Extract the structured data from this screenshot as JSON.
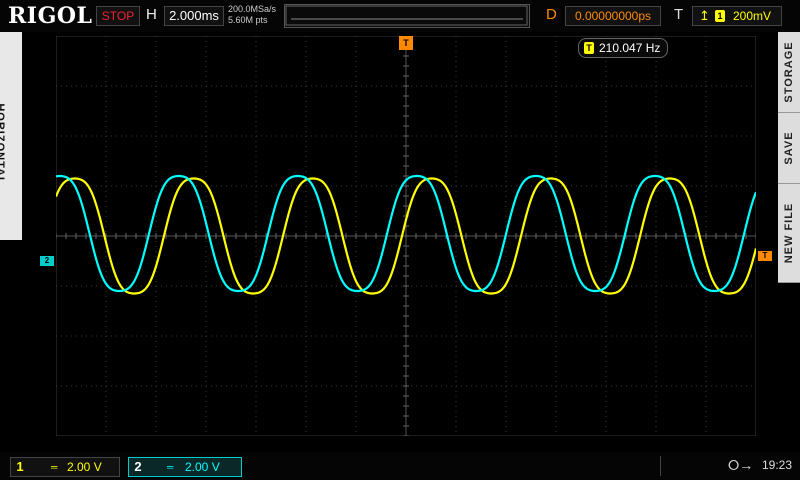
{
  "header": {
    "brand": "RIGOL",
    "run_state": "STOP",
    "horizontal_label": "H",
    "timebase": "2.000ms",
    "sample_rate": "200.0MSa/s",
    "memory_depth": "5.60M pts",
    "delay_label": "D",
    "delay_value": "0.00000000ps",
    "trigger_label": "T",
    "trigger_edge_icon": "rising-edge-icon",
    "trigger_source": "1",
    "trigger_level": "200mV",
    "trigger_position_marker": "T"
  },
  "left_menu": {
    "label": "HORIZONTAL"
  },
  "right_menu": {
    "tabs": [
      "STORAGE",
      "SAVE",
      "NEW FILE"
    ]
  },
  "measurement": {
    "source": "T",
    "frequency": "210.047 Hz"
  },
  "markers": {
    "ch2_offset": "2",
    "trigger_level": "T"
  },
  "channels": [
    {
      "number": "1",
      "coupling": "DC",
      "scale": "2.00 V",
      "color": "#ffff00"
    },
    {
      "number": "2",
      "coupling": "DC",
      "scale": "2.00 V",
      "color": "#00ffff"
    }
  ],
  "status": {
    "usb_icon": "usb-icon",
    "time": "19:23"
  },
  "colors": {
    "accent": "#ff8a00",
    "ch1": "#ffff00",
    "ch2": "#00ffff",
    "stop": "#ee2233"
  },
  "chart_data": {
    "type": "line",
    "xlabel": "",
    "ylabel": "",
    "x_divisions": 14,
    "y_divisions": 8,
    "timebase_per_div_ms": 2.0,
    "volts_per_div": 2.0,
    "grid": true,
    "series": [
      {
        "name": "1",
        "frequency_hz": 210.047,
        "amplitude_div": 1.35,
        "offset_div": 0.0,
        "phase_deg": 0
      },
      {
        "name": "2",
        "frequency_hz": 210.047,
        "amplitude_div": 1.35,
        "offset_div": 0.05,
        "phase_deg": 45
      }
    ]
  }
}
